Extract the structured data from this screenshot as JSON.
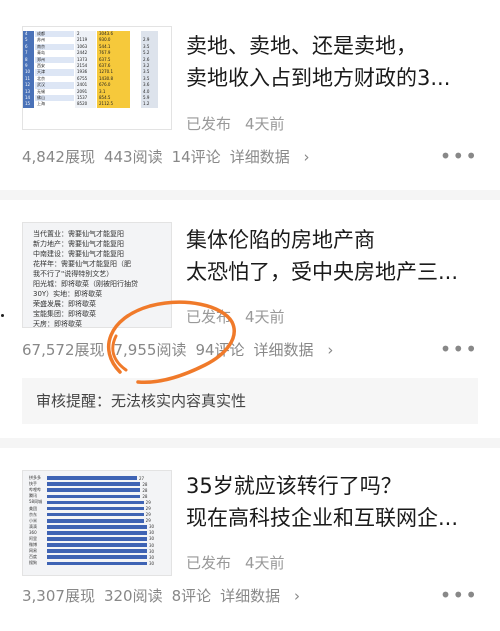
{
  "articles": [
    {
      "title_line1": "卖地、卖地、还是卖地，",
      "title_line2": "卖地收入占到地方财政的3...",
      "published": "已发布",
      "time": "4天前",
      "views": "4,842展现",
      "reads": "443阅读",
      "comments": "14评论",
      "details": "详细数据",
      "thumb_rows": [
        [
          "4",
          "成都",
          "2",
          "3043.6",
          "",
          ""
        ],
        [
          "5",
          "苏州",
          "2119",
          "930.0",
          "",
          "2.9"
        ],
        [
          "6",
          "南京",
          "1063",
          "544.1",
          "",
          "3.5"
        ],
        [
          "7",
          "青岛",
          "2442",
          "767.9",
          "",
          "5.2"
        ],
        [
          "8",
          "郑州",
          "1373",
          "637.5",
          "",
          "2.6"
        ],
        [
          "9",
          "西安",
          "2154",
          "637.6",
          "",
          "3.2"
        ],
        [
          "10",
          "天津",
          "1936",
          "1270.1",
          "",
          "3.5"
        ],
        [
          "11",
          "北京",
          "6755",
          "1430.8",
          "",
          "3.5"
        ],
        [
          "12",
          "武汉",
          "2401",
          "676.0",
          "",
          "3.6"
        ],
        [
          "13",
          "无锡",
          "2091",
          "3.1",
          "",
          "4.0"
        ],
        [
          "14",
          "佛山",
          "1537",
          "854.5",
          "",
          "5.9"
        ],
        [
          "15",
          "上海",
          "8520",
          "2112.5",
          "",
          "1.2"
        ]
      ]
    },
    {
      "title_line1": "集体伦陷的房地产商",
      "title_line2": "太恐怕了，受中央房地产三...",
      "published": "已发布",
      "time": "4天前",
      "views": "67,572展现",
      "reads": "7,955阅读",
      "comments": "94评论",
      "details": "详细数据",
      "thumb_lines": [
        "当代置业：需要仙气才能复阳",
        "新力地产：需要仙气才能复阳",
        "中南建设：需要仙气才能复阳",
        "花样年：需要仙气才能复阳（肥",
        "我不行了\"说得特别文艺）",
        "阳光城：即将歇菜（刚被阳行抽贷",
        "30Y）实地：即将歇菜",
        "荣盛发展：即将歇菜",
        "宝能集团：即将歇菜",
        "天房：即将歇菜"
      ]
    },
    {
      "title_line1": "35岁就应该转行了吗？",
      "title_line2": "现在高科技企业和互联网企...",
      "published": "已发布",
      "time": "4天前",
      "views": "3,307展现",
      "reads": "320阅读",
      "comments": "8评论",
      "details": "详细数据",
      "thumb_bars": [
        {
          "label": "拼多多",
          "value": 27
        },
        {
          "label": "快手",
          "value": 28
        },
        {
          "label": "哔哩哔",
          "value": 28
        },
        {
          "label": "腾讯",
          "value": 28
        },
        {
          "label": "58同城",
          "value": 29
        },
        {
          "label": "美团",
          "value": 29
        },
        {
          "label": "京东",
          "value": 29
        },
        {
          "label": "小米",
          "value": 29
        },
        {
          "label": "滴滴",
          "value": 30
        },
        {
          "label": "360",
          "value": 30
        },
        {
          "label": "阿里",
          "value": 30
        },
        {
          "label": "微博",
          "value": 30
        },
        {
          "label": "网易",
          "value": 30
        },
        {
          "label": "百度",
          "value": 30
        },
        {
          "label": "搜狗",
          "value": 30
        }
      ]
    }
  ],
  "review_notice": "审核提醒：无法核实内容真实性",
  "more_glyph": "•••",
  "chevron": "›",
  "colors": {
    "annotation": "#f07a2a",
    "bar": "#3e63b4"
  }
}
